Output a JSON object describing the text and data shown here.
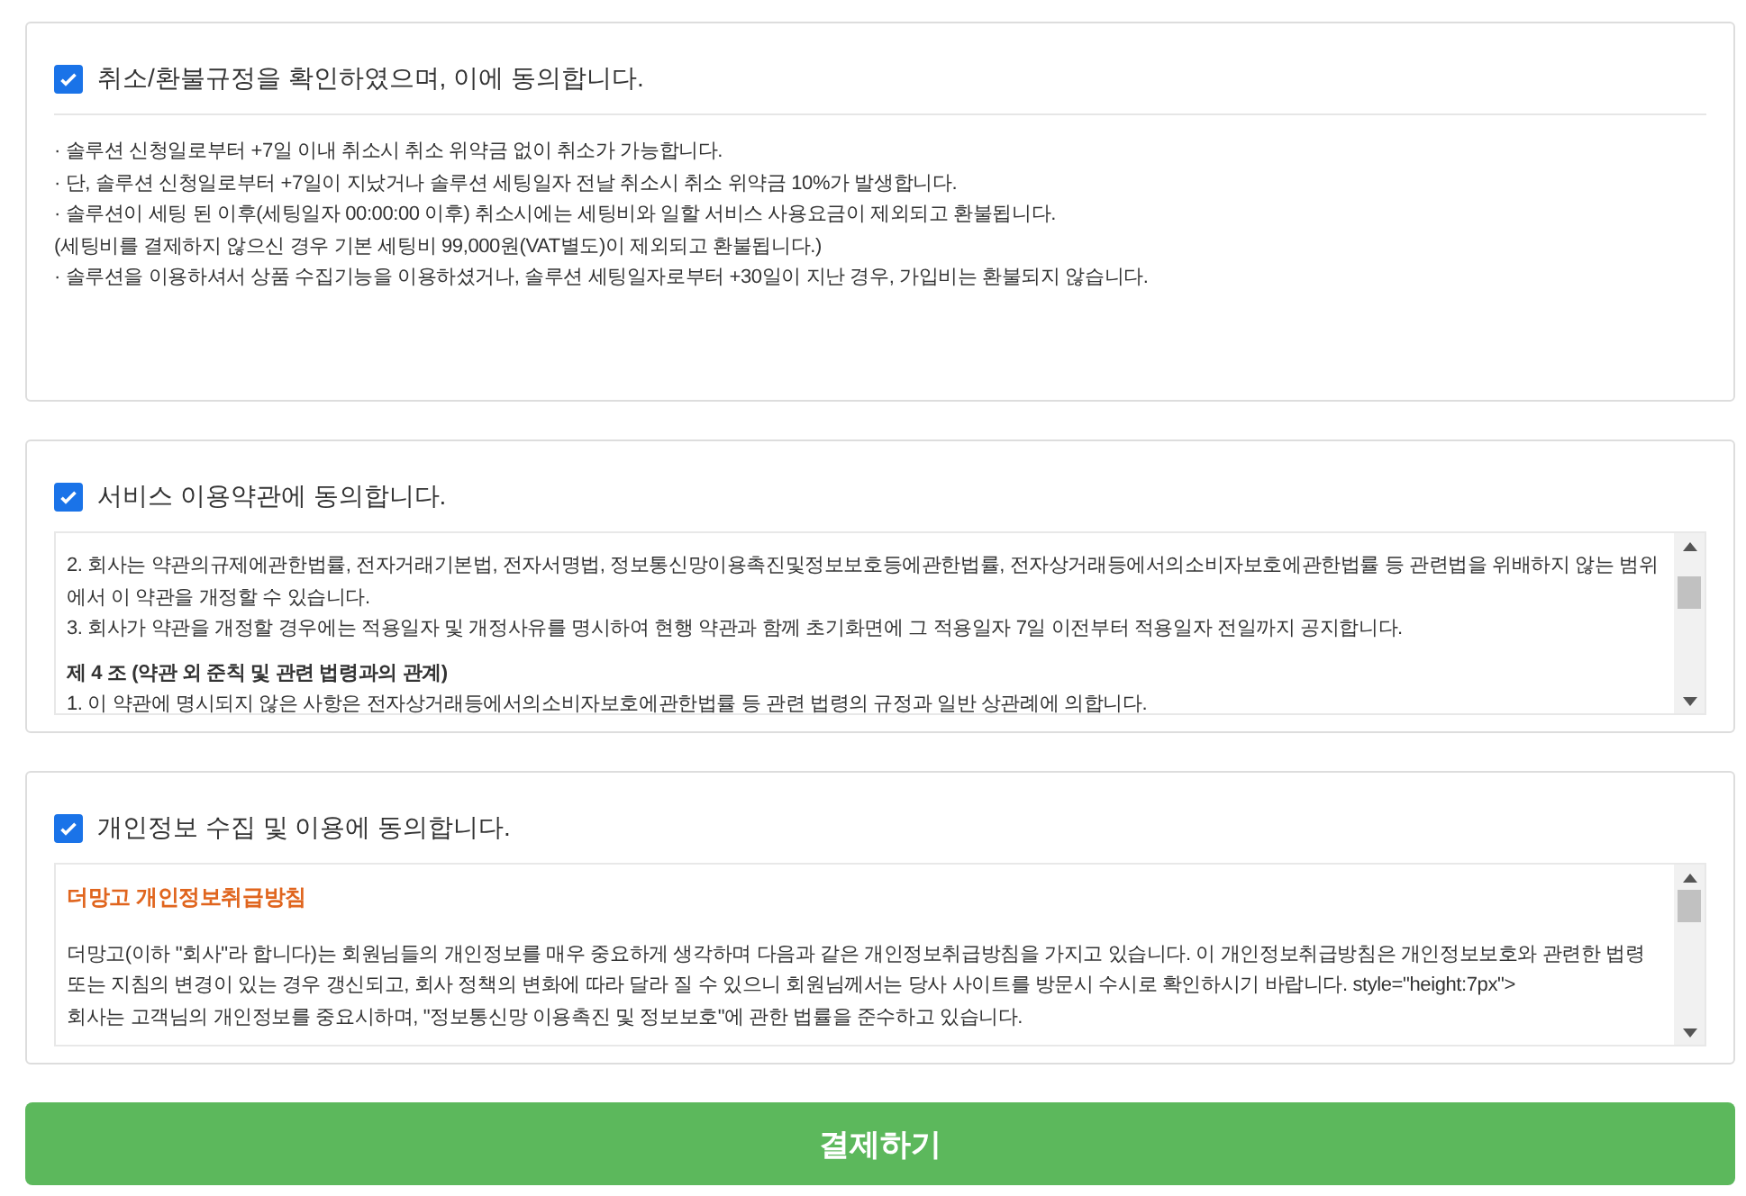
{
  "sections": [
    {
      "kind": "plain",
      "checked": true,
      "label": "취소/환불규정을 확인하였으며, 이에 동의합니다.",
      "lines": [
        {
          "kind": "text",
          "text": "· 솔루션 신청일로부터 +7일 이내 취소시 취소 위약금 없이 취소가 가능합니다."
        },
        {
          "kind": "text",
          "text": "· 단, 솔루션 신청일로부터 +7일이 지났거나 솔루션 세팅일자 전날 취소시 취소 위약금 10%가 발생합니다."
        },
        {
          "kind": "text",
          "text": "· 솔루션이 세팅 된 이후(세팅일자 00:00:00 이후) 취소시에는 세팅비와 일할 서비스 사용요금이 제외되고 환불됩니다."
        },
        {
          "kind": "text",
          "text": "(세팅비를 결제하지 않으신 경우 기본 세팅비 99,000원(VAT별도)이 제외되고 환불됩니다.)"
        },
        {
          "kind": "text",
          "text": "· 솔루션을 이용하셔서 상품 수집기능을 이용하셨거나, 솔루션 세팅일자로부터 +30일이 지난 경우, 가입비는 환불되지 않습니다."
        }
      ]
    },
    {
      "kind": "scroll",
      "checked": true,
      "label": "서비스 이용약관에 동의합니다.",
      "lines": [
        {
          "kind": "text",
          "text": "2. 회사는 약관의규제에관한법률, 전자거래기본법, 전자서명법, 정보통신망이용촉진및정보보호등에관한법률, 전자상거래등에서의소비자보호에관한법률 등 관련법을 위배하지 않는 범위에서 이 약관을 개정할 수 있습니다."
        },
        {
          "kind": "text",
          "text": "3. 회사가 약관을 개정할 경우에는 적용일자 및 개정사유를 명시하여 현행 약관과 함께 초기화면에 그 적용일자 7일 이전부터 적용일자 전일까지 공지합니다."
        },
        {
          "kind": "heading",
          "text": "제 4 조 (약관 외 준칙 및 관련 법령과의 관계)"
        },
        {
          "kind": "text",
          "text": "1. 이 약관에 명시되지 않은 사항은 전자상거래등에서의소비자보호에관한법률 등 관련 법령의 규정과 일반 상관례에 의합니다."
        }
      ]
    },
    {
      "kind": "scroll",
      "checked": true,
      "label": "개인정보 수집 및 이용에 동의합니다.",
      "lines": [
        {
          "kind": "title",
          "text": "더망고 개인정보취급방침"
        },
        {
          "kind": "text",
          "text": "더망고(이하 \"회사\"라 합니다)는 회원님들의 개인정보를 매우 중요하게 생각하며 다음과 같은 개인정보취급방침을 가지고 있습니다. 이 개인정보취급방침은 개인정보보호와 관련한 법령 또는 지침의 변경이 있는 경우 갱신되고, 회사 정책의 변화에 따라 달라 질 수 있으니 회원님께서는 당사 사이트를 방문시 수시로 확인하시기 바랍니다. style=\"height:7px\">"
        },
        {
          "kind": "text",
          "text": "회사는 고객님의 개인정보를 중요시하며, \"정보통신망 이용촉진 및 정보보호\"에 관한 법률을 준수하고 있습니다."
        }
      ]
    }
  ],
  "pay_button": "결제하기"
}
